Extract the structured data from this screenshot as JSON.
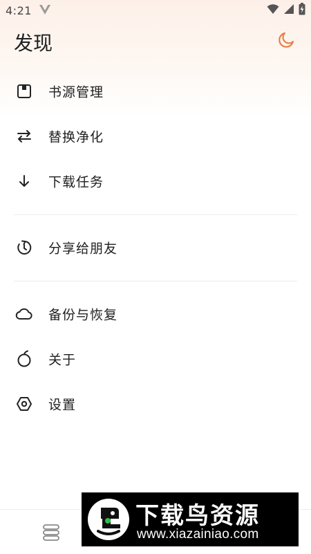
{
  "status_bar": {
    "time": "4:21"
  },
  "header": {
    "title": "发现"
  },
  "menu": {
    "items": [
      {
        "label": "书源管理",
        "icon": "book-source-icon"
      },
      {
        "label": "替换净化",
        "icon": "swap-arrows-icon"
      },
      {
        "label": "下载任务",
        "icon": "download-arrow-icon"
      },
      {
        "label": "分享给朋友",
        "icon": "share-refresh-icon"
      },
      {
        "label": "备份与恢复",
        "icon": "cloud-icon"
      },
      {
        "label": "关于",
        "icon": "apple-icon"
      },
      {
        "label": "设置",
        "icon": "settings-hexagon-icon"
      }
    ]
  },
  "colors": {
    "accent": "#e8804a",
    "text": "#1f1f1f",
    "divider": "#ececec"
  },
  "watermark": {
    "title": "下载鸟资源",
    "url": "www.xiazainiao.com"
  }
}
